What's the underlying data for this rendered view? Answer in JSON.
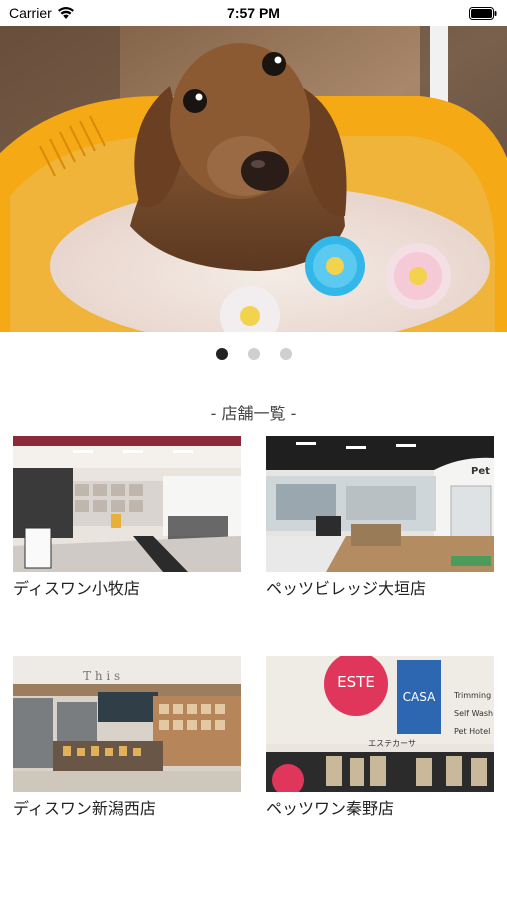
{
  "status_bar": {
    "carrier": "Carrier",
    "time": "7:57 PM",
    "icons": [
      "wifi-icon",
      "battery-icon"
    ]
  },
  "hero": {
    "image": "wet-dachshund-in-yellow-tub-photo",
    "page_count": 3,
    "current_page": 1
  },
  "section": {
    "title": "- 店舗一覧 -"
  },
  "stores": [
    {
      "name": "ディスワン小牧店",
      "image": "store-interior-photo"
    },
    {
      "name": "ペッツビレッジ大垣店",
      "image": "store-interior-photo"
    },
    {
      "name": "ディスワン新潟西店",
      "image": "store-interior-photo"
    },
    {
      "name": "ペッツワン秦野店",
      "image": "store-exterior-photo"
    }
  ],
  "photo_signage": {
    "este": "ESTE",
    "casa": "CASA",
    "esthe_casa_jp": "エステカーサ",
    "menu": [
      "Trimming",
      "Self Wash",
      "Pet Hotel"
    ]
  }
}
